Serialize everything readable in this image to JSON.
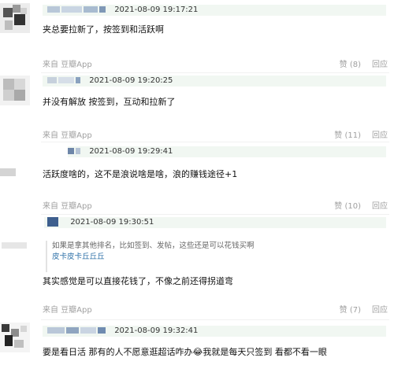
{
  "comments": [
    {
      "timestamp": "2021-08-09 19:17:21",
      "text": "夹总要拉新了，按签到和活跃啊",
      "source": "来自 豆瓣App",
      "likes": "赞 (8)",
      "reply": "回应"
    },
    {
      "timestamp": "2021-08-09 19:20:25",
      "text": "并没有解放 按签到，互动和拉新了",
      "source": "来自 豆瓣App",
      "likes": "赞 (11)",
      "reply": "回应"
    },
    {
      "timestamp": "2021-08-09 19:29:41",
      "text": "活跃度啥的，这不是浪说啥是啥，浪的赚钱途径+1",
      "source": "来自 豆瓣App",
      "likes": "赞 (10)",
      "reply": "回应"
    },
    {
      "timestamp": "2021-08-09 19:30:51",
      "quote_text": "如果是拿其他排名，比如签到、发帖，这些还是可以花钱买啊",
      "quote_user": "皮卡皮卡丘丘丘",
      "text": "其实感觉是可以直接花钱了，不像之前还得拐道弯",
      "source": "来自 豆瓣App",
      "likes": "赞 (7)",
      "reply": "回应"
    },
    {
      "timestamp": "2021-08-09 19:32:41",
      "text": "要是看日活 那有的人不愿意逛超话咋办😂我就是每天只签到 看都不看一眼"
    }
  ],
  "colors": {
    "meta_bar_bg": "#f1f7f2",
    "link_blue": "#3374aa",
    "muted": "#a0a0a0"
  }
}
